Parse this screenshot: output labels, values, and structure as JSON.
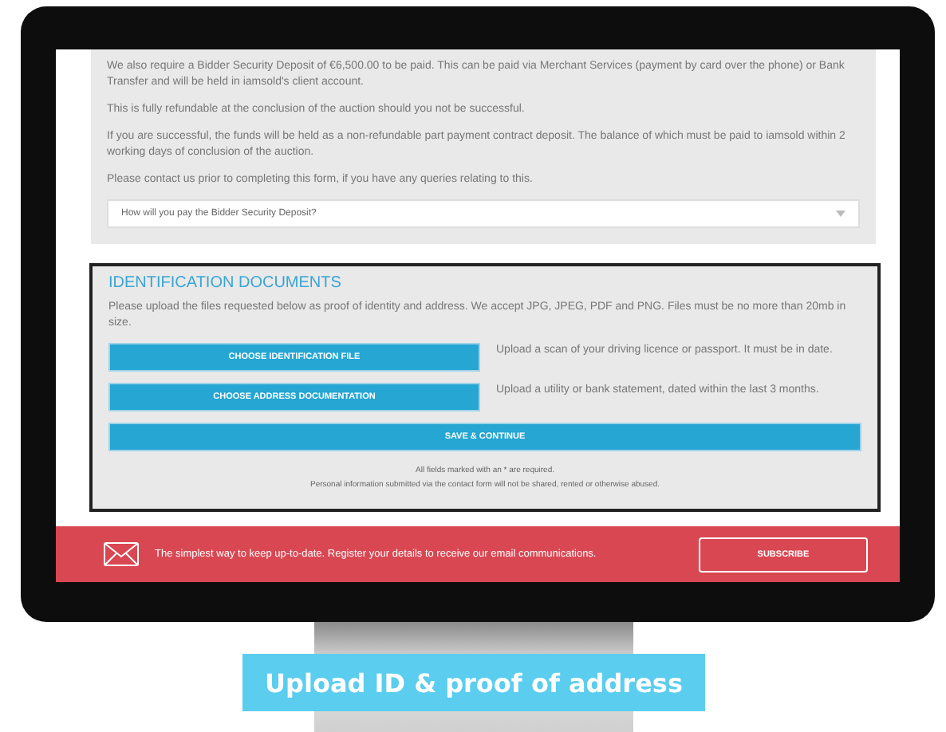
{
  "intro_paragraphs": [
    "We also require a Bidder Security Deposit of €6,500.00 to be paid. This can be paid via Merchant Services (payment by card over the phone) or Bank Transfer and will be held in iamsold's client account.",
    "This is fully refundable at the conclusion of the auction should you not be successful.",
    "If you are successful, the funds will be held as a non-refundable part payment contract deposit. The balance of which must be paid to iamsold within 2 working days of conclusion of the auction.",
    "Please contact us prior to completing this form, if you have any queries relating to this."
  ],
  "payment_select": {
    "placeholder": "How will you pay the Bidder Security Deposit?"
  },
  "identification": {
    "title": "IDENTIFICATION DOCUMENTS",
    "description": "Please upload the files requested below as proof of identity and address. We accept JPG, JPEG, PDF and PNG. Files must be no more than 20mb in size.",
    "uploads": [
      {
        "button": "CHOOSE IDENTIFICATION FILE",
        "hint": "Upload a scan of your driving licence or passport. It must be in date."
      },
      {
        "button": "CHOOSE ADDRESS DOCUMENTATION",
        "hint": "Upload a utility or bank statement, dated within the last 3 months."
      }
    ],
    "submit": "SAVE & CONTINUE",
    "notes": [
      "All fields marked with an * are required.",
      "Personal information submitted via the contact form will not be shared, rented or otherwise abused."
    ]
  },
  "newsletter": {
    "text": "The simplest way to keep up-to-date. Register your details to receive our email communications.",
    "button": "SUBSCRIBE"
  },
  "caption": "Upload ID & proof of address"
}
